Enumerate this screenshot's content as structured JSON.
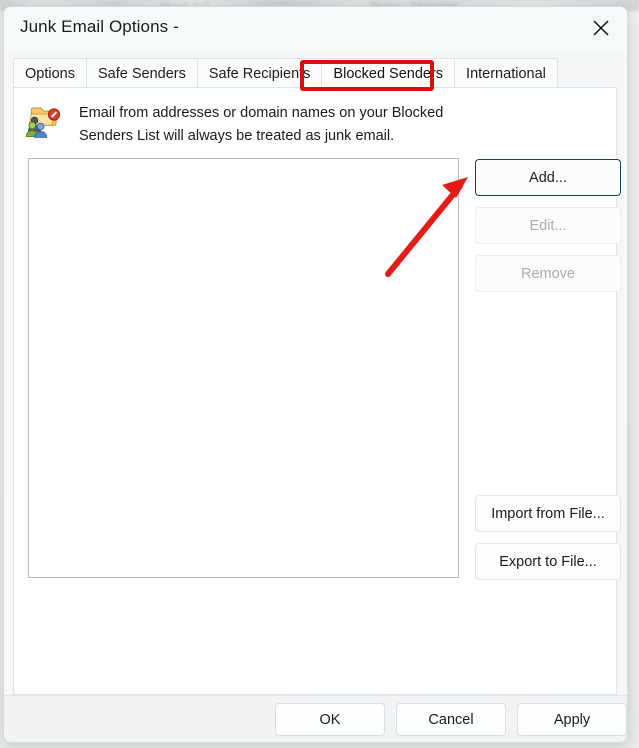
{
  "window": {
    "title": "Junk Email Options -",
    "close_icon": "close-icon"
  },
  "tabs": [
    {
      "label": "Options",
      "active": false
    },
    {
      "label": "Safe Senders",
      "active": false
    },
    {
      "label": "Safe Recipients",
      "active": false
    },
    {
      "label": "Blocked Senders",
      "active": true
    },
    {
      "label": "International",
      "active": false
    }
  ],
  "panel": {
    "icon": "blocked-senders-folder-icon",
    "description": "Email from addresses or domain names on your Blocked Senders List will always be treated as junk email.",
    "listbox": {
      "name": "blocked-senders-list",
      "items": []
    },
    "side_buttons": [
      {
        "label": "Add...",
        "state": "focused"
      },
      {
        "label": "Edit...",
        "state": "disabled"
      },
      {
        "label": "Remove",
        "state": "disabled"
      },
      {
        "label": "Import from File...",
        "state": "enabled"
      },
      {
        "label": "Export to File...",
        "state": "enabled"
      }
    ]
  },
  "footer": {
    "ok": "OK",
    "cancel": "Cancel",
    "apply": "Apply"
  },
  "annotations": {
    "tab_highlight_color": "#d41010",
    "arrow_color": "#e41b17",
    "highlighted_tab": "Blocked Senders",
    "arrow_points_to": "Add..."
  },
  "colors": {
    "dialog_background": "#f5f7f8",
    "panel_background": "#ffffff",
    "footer_background": "#f1f3f4",
    "focus_border": "#12435c",
    "disabled_text": "#a9adb0"
  }
}
